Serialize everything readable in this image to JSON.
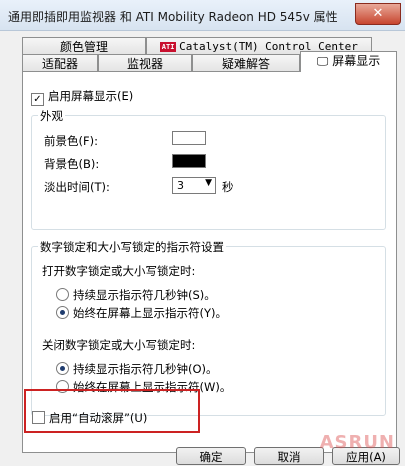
{
  "window": {
    "title": "通用即插即用监视器 和 ATI Mobility Radeon HD 545v 属性",
    "close_symbol": "✕"
  },
  "tabs": {
    "row1": [
      {
        "label": "颜色管理"
      },
      {
        "label": "Catalyst(TM) Control Center",
        "logo": "ATI"
      }
    ],
    "row2": [
      {
        "label": "适配器"
      },
      {
        "label": "监视器"
      },
      {
        "label": "疑难解答"
      },
      {
        "label": "屏幕显示",
        "active": true
      }
    ]
  },
  "osd": {
    "enable_label": "启用屏幕显示(E)",
    "enable_checked": true,
    "appearance": {
      "title": "外观",
      "fg_label": "前景色(F):",
      "bg_label": "背景色(B):",
      "fade_label": "淡出时间(T):",
      "fade_value": "3",
      "fade_unit": "秒",
      "fg_color": "#ffffff",
      "bg_color": "#000000"
    },
    "lock_group": {
      "title": "数字锁定和大小写锁定的指示符设置",
      "on_title": "打开数字锁定或大小写锁定时:",
      "on_options": [
        "持续显示指示符几秒钟(S)。",
        "始终在屏幕上显示指示符(Y)。"
      ],
      "on_selected": 1,
      "off_title": "关闭数字锁定或大小写锁定时:",
      "off_options": [
        "持续显示指示符几秒钟(O)。",
        "始终在屏幕上显示指示符(W)。"
      ],
      "off_selected": 0
    },
    "autoscroll_label": "启用“自动滚屏”(U)",
    "autoscroll_checked": false
  },
  "buttons": {
    "ok": "确定",
    "cancel": "取消",
    "apply": "应用(A)"
  },
  "watermark": "ASRUN",
  "colors": {
    "highlight": "#cc2222",
    "radio_dot": "#1f3c6e"
  }
}
